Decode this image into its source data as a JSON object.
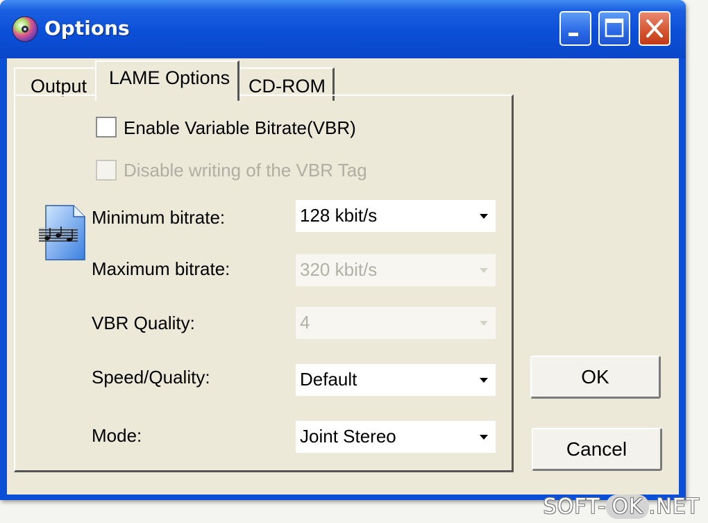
{
  "window": {
    "title": "Options"
  },
  "tabs": [
    {
      "label": "Output"
    },
    {
      "label": "LAME Options"
    },
    {
      "label": "CD-ROM"
    }
  ],
  "lame_options": {
    "vbr_checkbox": {
      "label": "Enable Variable Bitrate(VBR)",
      "checked": false
    },
    "vbr_tag_checkbox": {
      "label": "Disable writing of the VBR Tag",
      "checked": false,
      "disabled": true
    },
    "min_bitrate": {
      "label": "Minimum bitrate:",
      "value": "128 kbit/s"
    },
    "max_bitrate": {
      "label": "Maximum bitrate:",
      "value": "320 kbit/s",
      "disabled": true
    },
    "vbr_quality": {
      "label": "VBR Quality:",
      "value": "4",
      "disabled": true
    },
    "speed_quality": {
      "label": "Speed/Quality:",
      "value": "Default"
    },
    "mode": {
      "label": "Mode:",
      "value": "Joint Stereo"
    }
  },
  "buttons": {
    "ok": "OK",
    "cancel": "Cancel"
  },
  "watermark": {
    "left": "SOFT-",
    "middle": "OK",
    "right": ".NET"
  },
  "colors": {
    "titlebar": "#0a4fd6",
    "dialog_bg": "#ece9d8",
    "close_button": "#d5532f"
  },
  "icons": [
    "app-disc-icon",
    "minimize-icon",
    "maximize-icon",
    "close-icon",
    "audio-file-icon",
    "dropdown-arrow-icon"
  ]
}
